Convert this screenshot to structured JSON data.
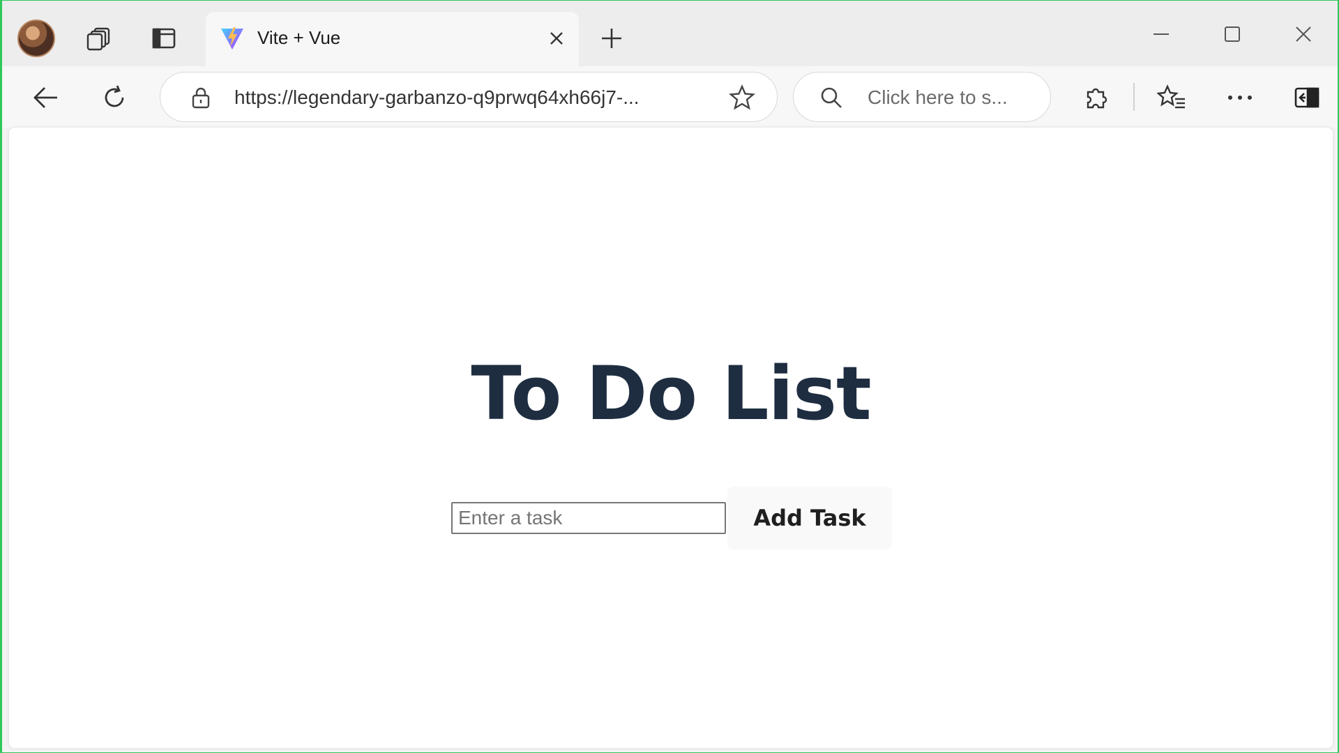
{
  "browser": {
    "tab": {
      "title": "Vite + Vue"
    },
    "address_bar": {
      "url": "https://legendary-garbanzo-q9prwq64xh66j7-..."
    },
    "search_box": {
      "placeholder": "Click here to s..."
    }
  },
  "page": {
    "title": "To Do List",
    "task_input": {
      "placeholder": "Enter a task",
      "value": ""
    },
    "add_button_label": "Add Task"
  },
  "colors": {
    "window_border": "#2fc85a",
    "title_text": "#1e2d40",
    "favicon_gradient": [
      "#41d1ff",
      "#bd34fe",
      "#ffbd4f"
    ]
  },
  "icons": [
    "avatar",
    "workspaces-icon",
    "vertical-tabs-icon",
    "vite-favicon-icon",
    "close-icon",
    "plus-icon",
    "minimize-icon",
    "maximize-icon",
    "window-close-icon",
    "back-arrow-icon",
    "refresh-icon",
    "lock-icon",
    "star-icon",
    "search-icon",
    "extensions-icon",
    "favorites-icon",
    "more-icon",
    "sidebar-icon"
  ]
}
